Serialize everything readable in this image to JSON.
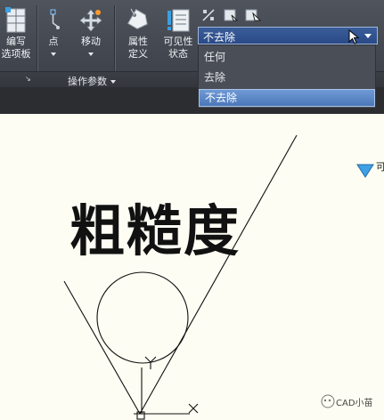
{
  "ribbon": {
    "tools": [
      {
        "name": "edit-palette",
        "line1": "编写",
        "line2": "选项板"
      },
      {
        "name": "point",
        "line1": "点",
        "line2": ""
      },
      {
        "name": "move",
        "line1": "移动",
        "line2": ""
      },
      {
        "name": "attribute-definition",
        "line1": "属性",
        "line2": "定义"
      },
      {
        "name": "visibility-state",
        "line1": "可见性",
        "line2": "状态"
      }
    ],
    "panel_title": "操作参数"
  },
  "dropdown": {
    "value": "不去除",
    "options": [
      "任何",
      "去除",
      "不去除"
    ],
    "selected_index": 2
  },
  "drawing": {
    "title": "粗糙度",
    "right_label": "可"
  },
  "watermark": "CAD小苗"
}
